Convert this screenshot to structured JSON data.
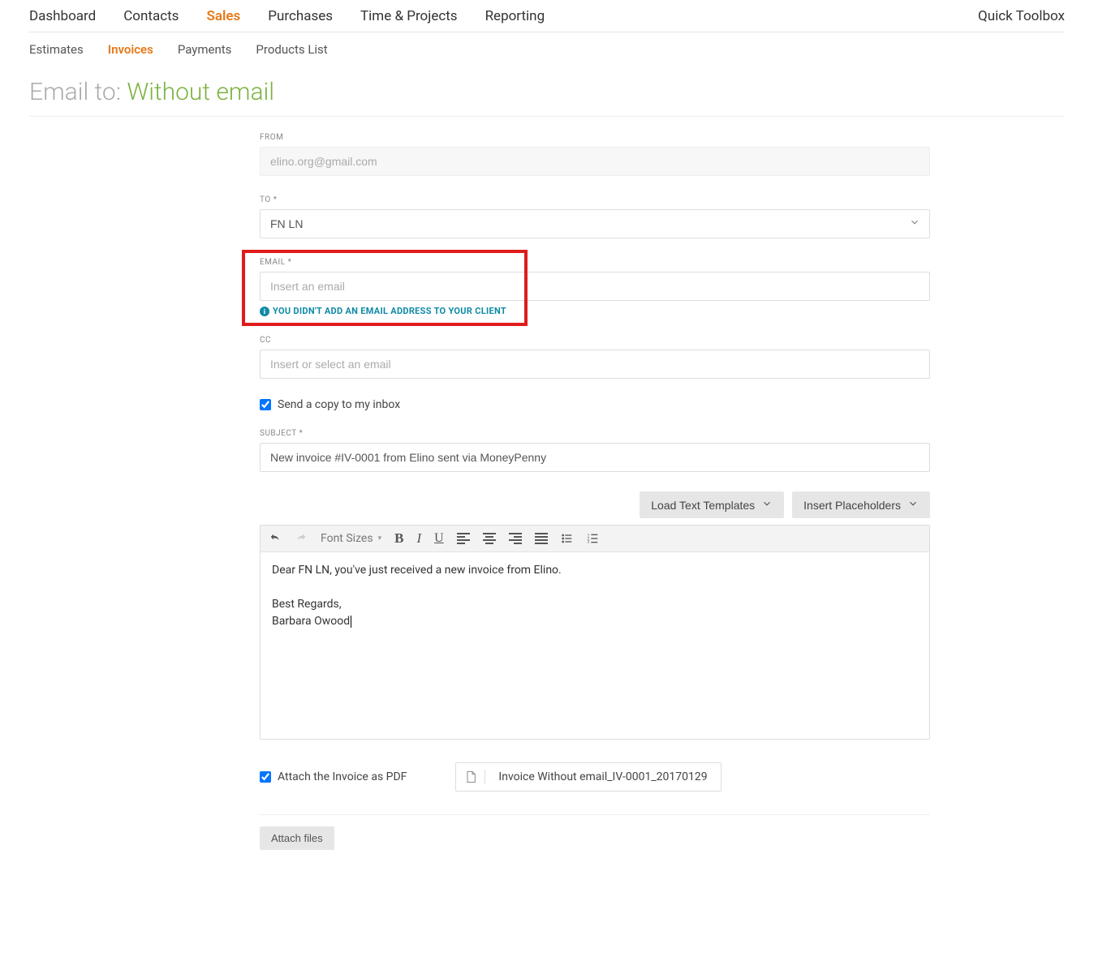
{
  "nav": {
    "items": [
      "Dashboard",
      "Contacts",
      "Sales",
      "Purchases",
      "Time & Projects",
      "Reporting"
    ],
    "active_index": 2,
    "quick_toolbox": "Quick Toolbox"
  },
  "subnav": {
    "items": [
      "Estimates",
      "Invoices",
      "Payments",
      "Products List"
    ],
    "active_index": 1
  },
  "title": {
    "prefix": "Email to: ",
    "value": "Without email"
  },
  "form": {
    "from_label": "FROM",
    "from_value": "elino.org@gmail.com",
    "to_label": "TO *",
    "to_value": "FN LN",
    "email_label": "EMAIL *",
    "email_placeholder": "Insert an email",
    "email_warning": "YOU DIDN'T ADD AN EMAIL ADDRESS TO YOUR CLIENT",
    "cc_label": "CC",
    "cc_placeholder": "Insert or select an email",
    "send_copy_label": "Send a copy to my inbox",
    "send_copy_checked": true,
    "subject_label": "SUBJECT *",
    "subject_value": "New invoice #IV-0001 from Elino sent via MoneyPenny"
  },
  "editor": {
    "load_templates": "Load Text Templates",
    "insert_placeholders": "Insert Placeholders",
    "font_sizes_label": "Font Sizes",
    "body_line1": "Dear FN LN, you've just received a new invoice from Elino.",
    "body_line2": "Best Regards,",
    "body_line3": "Barbara Owood"
  },
  "attachment": {
    "attach_pdf_label": "Attach the Invoice as PDF",
    "attach_pdf_checked": true,
    "file_name": "Invoice Without email_IV-0001_20170129",
    "attach_files_label": "Attach files"
  }
}
